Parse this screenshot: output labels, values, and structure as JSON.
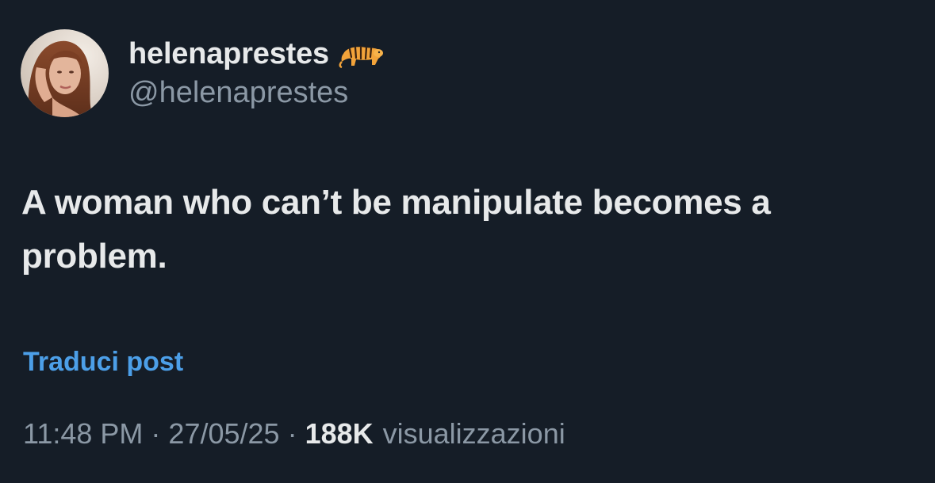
{
  "author": {
    "display_name": "helenaprestes",
    "handle": "@helenaprestes",
    "badge_icon": "tiger-emoji-icon"
  },
  "post": {
    "text": "A woman who can’t be manipulate becomes a problem."
  },
  "actions": {
    "translate_label": "Traduci post"
  },
  "meta": {
    "time": "11:48 PM",
    "separator": "·",
    "date": "27/05/25",
    "views_count": "188K",
    "views_label": "visualizzazioni"
  },
  "colors": {
    "background": "#151d27",
    "primary_text": "#e7e9ea",
    "secondary_text": "#8b98a5",
    "link": "#4c9fe8"
  }
}
